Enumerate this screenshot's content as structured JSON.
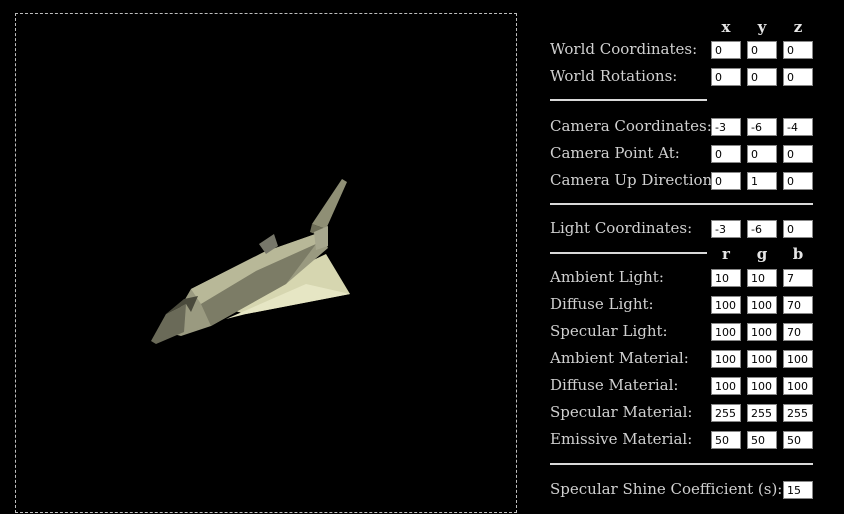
{
  "viewport": {
    "label": ""
  },
  "headers_xyz": [
    "x",
    "y",
    "z"
  ],
  "headers_rgb": [
    "r",
    "g",
    "b"
  ],
  "world": {
    "coords_label": "World Coordinates:",
    "coords": [
      "0",
      "0",
      "0"
    ],
    "rot_label": "World Rotations:",
    "rot": [
      "0",
      "0",
      "0"
    ]
  },
  "camera": {
    "coords_label": "Camera Coordinates:",
    "coords": [
      "-3",
      "-6",
      "-4"
    ],
    "point_label": "Camera Point At:",
    "point": [
      "0",
      "0",
      "0"
    ],
    "up_label": "Camera Up Direction:",
    "up": [
      "0",
      "1",
      "0"
    ]
  },
  "light": {
    "coords_label": "Light Coordinates:",
    "coords": [
      "-3",
      "-6",
      "0"
    ]
  },
  "lighting": {
    "ambient_light_label": "Ambient Light:",
    "ambient_light": [
      "10",
      "10",
      "7"
    ],
    "diffuse_light_label": "Diffuse Light:",
    "diffuse_light": [
      "100",
      "100",
      "70"
    ],
    "specular_light_label": "Specular Light:",
    "specular_light": [
      "100",
      "100",
      "70"
    ],
    "ambient_material_label": "Ambient Material:",
    "ambient_material": [
      "100",
      "100",
      "100"
    ],
    "diffuse_material_label": "Diffuse Material:",
    "diffuse_material": [
      "100",
      "100",
      "100"
    ],
    "specular_material_label": "Specular Material:",
    "specular_material": [
      "255",
      "255",
      "255"
    ],
    "emissive_material_label": "Emissive Material:",
    "emissive_material": [
      "50",
      "50",
      "50"
    ]
  },
  "shine": {
    "label": "Specular Shine Coefficient (s):",
    "value": "15"
  },
  "colors": {
    "background": "#000000",
    "ship_hull": "#c8c8a8",
    "ship_dark": "#5a5a48"
  }
}
